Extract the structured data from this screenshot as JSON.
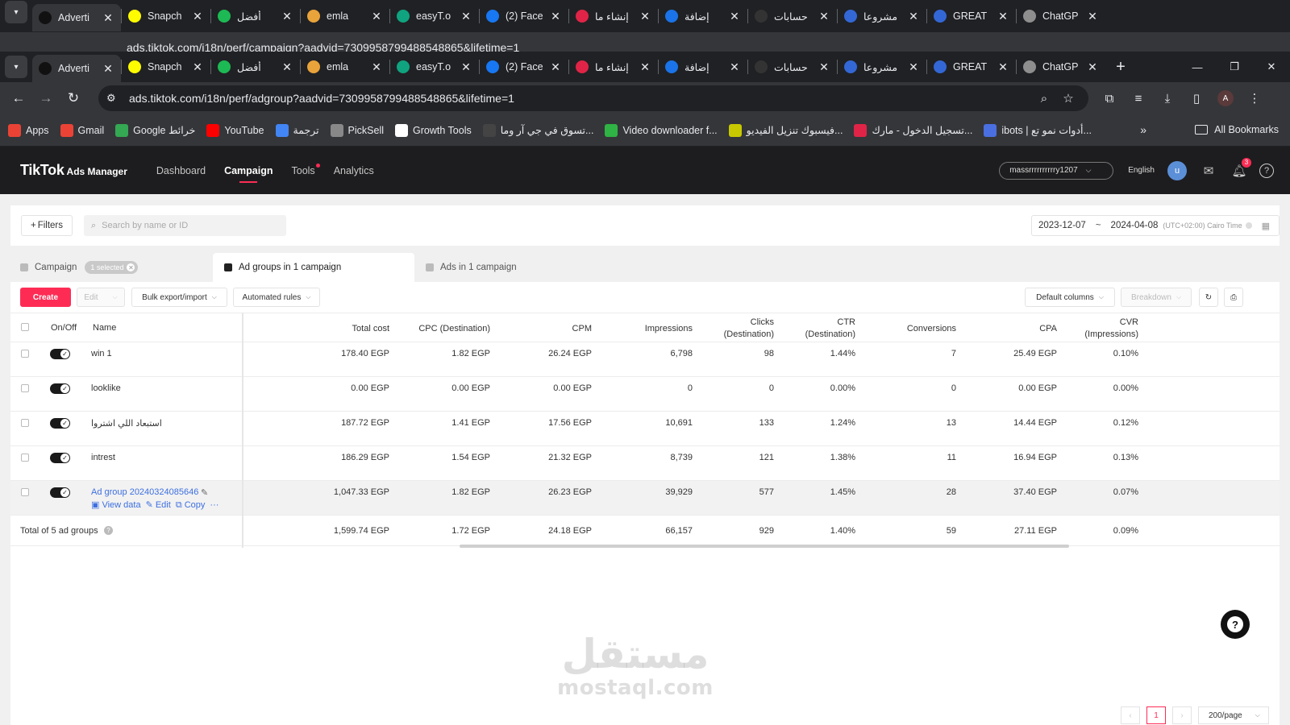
{
  "browser": {
    "tabs": [
      {
        "label": "Adverti",
        "active": true,
        "color": "#111111",
        "icon": "tiktok-icon"
      },
      {
        "label": "Snapch",
        "color": "#fffc00",
        "icon": "snapchat-icon"
      },
      {
        "label": "أفضل",
        "color": "#1db954",
        "icon": "lock-icon"
      },
      {
        "label": "emla",
        "color": "#e8a33a",
        "icon": "emla-icon"
      },
      {
        "label": "easyT.o",
        "color": "#10a37f",
        "icon": "easyt-icon"
      },
      {
        "label": "(2) Face",
        "color": "#1877f2",
        "icon": "facebook-icon"
      },
      {
        "label": "إنشاء ما",
        "color": "#e02447",
        "icon": "swirl-icon"
      },
      {
        "label": "إضافة",
        "color": "#1a73e8",
        "icon": "circle-icon"
      },
      {
        "label": "حسابات",
        "color": "#333333",
        "icon": "moon-icon"
      },
      {
        "label": "مشروعا",
        "color": "#3367d6",
        "icon": "c-icon"
      },
      {
        "label": "GREAT",
        "color": "#3367d6",
        "icon": "c-icon"
      },
      {
        "label": "ChatGP",
        "color": "#8e8e8e",
        "icon": "chatgpt-icon"
      }
    ],
    "ghost_url": "ads.tiktok.com/i18n/perf/campaign?aadvid=7309958799488548865&lifetime=1",
    "url": "ads.tiktok.com/i18n/perf/adgroup?aadvid=7309958799488548865&lifetime=1",
    "profile_initial": "A",
    "bookmarks": [
      {
        "label": "Apps",
        "icon": "apps-grid-icon",
        "color": "#ea4335"
      },
      {
        "label": "Gmail",
        "icon": "gmail-icon",
        "color": "#ea4335"
      },
      {
        "label": "Google خرائط",
        "icon": "maps-icon",
        "color": "#34a853"
      },
      {
        "label": "YouTube",
        "icon": "youtube-icon",
        "color": "#ff0000"
      },
      {
        "label": "ترجمة",
        "icon": "translate-icon",
        "color": "#4285f4"
      },
      {
        "label": "PickSell",
        "icon": "picksell-icon",
        "color": "#888888"
      },
      {
        "label": "Growth Tools",
        "icon": "growth-tools-icon",
        "color": "#ffffff"
      },
      {
        "label": "تسوق في جي آر وما...",
        "icon": "shop-icon",
        "color": "#444444"
      },
      {
        "label": "Video downloader f...",
        "icon": "download-icon",
        "color": "#2fb344"
      },
      {
        "label": "فيسبوك تنزيل الفيديو...",
        "icon": "fb-download-icon",
        "color": "#c8c800"
      },
      {
        "label": "تسجيل الدخول - مارك...",
        "icon": "login-icon",
        "color": "#e02447"
      },
      {
        "label": "ibots | أدوات نمو تع...",
        "icon": "ibots-icon",
        "color": "#4a6fe0"
      }
    ],
    "all_bookmarks": "All Bookmarks"
  },
  "header": {
    "logo_main": "TikTok",
    "logo_sub": "Ads Manager",
    "nav": [
      "Dashboard",
      "Campaign",
      "Tools",
      "Analytics"
    ],
    "active_nav": "Campaign",
    "account": "massrrrrrrrrrry1207",
    "language": "English",
    "avatar_initial": "u",
    "notification_count": "3"
  },
  "filters": {
    "filters_label": "Filters",
    "search_placeholder": "Search by name or ID",
    "date_start": "2023-12-07",
    "date_sep": "~",
    "date_end": "2024-04-08",
    "timezone": "(UTC+02:00) Cairo Time"
  },
  "level_tabs": {
    "campaign": "Campaign",
    "selected_chip": "1 selected",
    "adgroups": "Ad groups in 1 campaign",
    "ads": "Ads in 1 campaign"
  },
  "toolbar": {
    "create": "Create",
    "edit": "Edit",
    "bulk": "Bulk export/import",
    "rules": "Automated rules",
    "columns": "Default columns",
    "breakdown": "Breakdown"
  },
  "table": {
    "columns": {
      "onoff": "On/Off",
      "name": "Name",
      "total_cost": "Total cost",
      "cpc": "CPC (Destination)",
      "cpm": "CPM",
      "impressions": "Impressions",
      "clicks_1": "Clicks",
      "clicks_2": "(Destination)",
      "ctr_1": "CTR",
      "ctr_2": "(Destination)",
      "conversions": "Conversions",
      "cpa": "CPA",
      "cvr_1": "CVR",
      "cvr_2": "(Impressions)"
    },
    "rows": [
      {
        "name": "win 1",
        "total_cost": "178.40 EGP",
        "cpc": "1.82 EGP",
        "cpm": "26.24 EGP",
        "impressions": "6,798",
        "clicks": "98",
        "ctr": "1.44%",
        "conversions": "7",
        "cpa": "25.49 EGP",
        "cvr": "0.10%",
        "on": true
      },
      {
        "name": "looklike",
        "total_cost": "0.00 EGP",
        "cpc": "0.00 EGP",
        "cpm": "0.00 EGP",
        "impressions": "0",
        "clicks": "0",
        "ctr": "0.00%",
        "conversions": "0",
        "cpa": "0.00 EGP",
        "cvr": "0.00%",
        "on": true
      },
      {
        "name": "استبعاد اللي اشتروا",
        "total_cost": "187.72 EGP",
        "cpc": "1.41 EGP",
        "cpm": "17.56 EGP",
        "impressions": "10,691",
        "clicks": "133",
        "ctr": "1.24%",
        "conversions": "13",
        "cpa": "14.44 EGP",
        "cvr": "0.12%",
        "on": true
      },
      {
        "name": "intrest",
        "total_cost": "186.29 EGP",
        "cpc": "1.54 EGP",
        "cpm": "21.32 EGP",
        "impressions": "8,739",
        "clicks": "121",
        "ctr": "1.38%",
        "conversions": "11",
        "cpa": "16.94 EGP",
        "cvr": "0.13%",
        "on": true
      },
      {
        "name": "Ad group 20240324085646",
        "total_cost": "1,047.33 EGP",
        "cpc": "1.82 EGP",
        "cpm": "26.23 EGP",
        "impressions": "39,929",
        "clicks": "577",
        "ctr": "1.45%",
        "conversions": "28",
        "cpa": "37.40 EGP",
        "cvr": "0.07%",
        "on": true,
        "highlighted": true,
        "actions": {
          "view": "View data",
          "edit": "Edit",
          "copy": "Copy",
          "more": "···"
        }
      }
    ],
    "total": {
      "label": "Total of 5 ad groups",
      "total_cost": "1,599.74 EGP",
      "cpc": "1.72 EGP",
      "cpm": "24.18 EGP",
      "impressions": "66,157",
      "clicks": "929",
      "ctr": "1.40%",
      "conversions": "59",
      "cpa": "27.11 EGP",
      "cvr": "0.09%"
    }
  },
  "pagination": {
    "current": "1",
    "page_size": "200/page"
  },
  "watermark": {
    "arabic": "مستقل",
    "latin": "mostaql.com"
  }
}
